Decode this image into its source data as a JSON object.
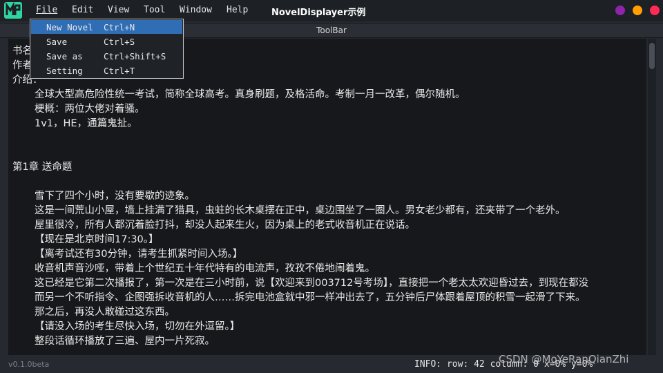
{
  "menubar": {
    "items": [
      "File",
      "Edit",
      "View",
      "Tool",
      "Window",
      "Help"
    ],
    "title": "NovelDisplayer示例"
  },
  "window_buttons": {
    "colors": [
      "#8e24aa",
      "#ff9f00",
      "#ff2a55"
    ]
  },
  "toolbar": {
    "label": "ToolBar"
  },
  "file_menu": {
    "items": [
      {
        "label": "New Novel",
        "shortcut": "Ctrl+N"
      },
      {
        "label": "Save",
        "shortcut": "Ctrl+S"
      },
      {
        "label": "Save as",
        "shortcut": "Ctrl+Shift+S"
      },
      {
        "label": "Setting",
        "shortcut": "Ctrl+T"
      }
    ]
  },
  "editor": {
    "lines": [
      "书名：",
      "作者：",
      "介绍：",
      "全球大型高危险性统一考试，简称全球高考。真身刷题，及格活命。考制一月一改革，偶尔随机。",
      "梗概：两位大佬对着骚。",
      "1v1，HE，通篇鬼扯。",
      "第1章 送命题",
      "雪下了四个小时，没有要歇的迹象。",
      "这是一间荒山小屋，墙上挂满了猎具，虫蛀的长木桌摆在正中，桌边围坐了一圈人。男女老少都有，还夹带了一个老外。",
      "屋里很冷，所有人都沉着脸打抖，却没人起来生火，因为桌上的老式收音机正在说话。",
      "【现在是北京时间17:30。】",
      "【离考试还有30分钟，请考生抓紧时间入场。】",
      "收音机声音沙哑，带着上个世纪五十年代特有的电流声，孜孜不倦地闹着鬼。",
      "这已经是它第二次播报了，第一次是在三小时前，说【欢迎来到003712号考场】，直接把一个老太太欢迎昏过去，到现在都没",
      "而另一个不听指令、企图强拆收音机的人……拆完电池盒就中邪一样冲出去了，五分钟后尸体跟着屋顶的积雪一起滑了下来。",
      "那之后，再没人敢碰过这东西。",
      "【请没入场的考生尽快入场，切勿在外逗留。】",
      "整段话循环播放了三遍、屋内一片死寂。"
    ]
  },
  "status": {
    "version": "v0.1.0beta",
    "info": "INFO: row: 42  column: 0   x=0% y=0%"
  },
  "watermark": "CSDN @MoYeRanQianZhi"
}
